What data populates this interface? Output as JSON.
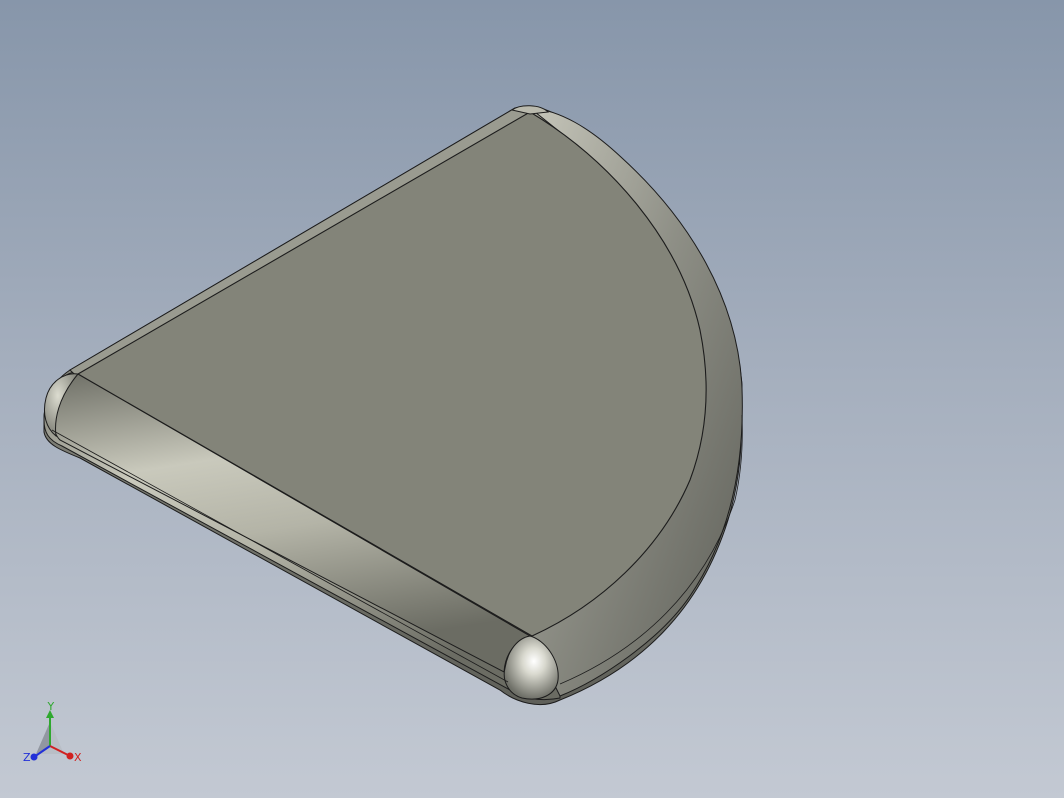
{
  "viewport": {
    "background_top": "#8796aa",
    "background_bottom": "#c3c9d3"
  },
  "model": {
    "face_color": "#838479",
    "edge_color": "#1c1c1c",
    "fillet_light": "#d4d4c8",
    "fillet_dark": "#5a5a54"
  },
  "triad": {
    "x_label": "X",
    "y_label": "Y",
    "z_label": "Z",
    "x_color": "#d12020",
    "y_color": "#2fa82f",
    "z_color": "#2230d8"
  }
}
